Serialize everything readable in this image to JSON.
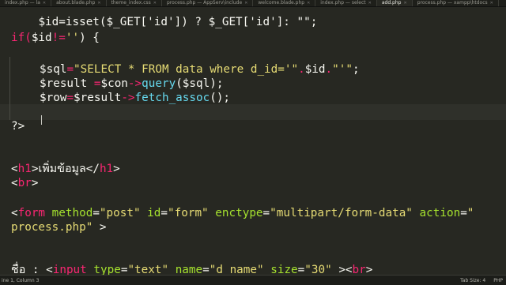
{
  "tabs": [
    {
      "label": "index.php — la",
      "active": false
    },
    {
      "label": "about.blade.php",
      "active": false
    },
    {
      "label": "theme_index.css",
      "active": false
    },
    {
      "label": "process.php — AppServ\\include",
      "active": false
    },
    {
      "label": "welcome.blade.php",
      "active": false
    },
    {
      "label": "index.php — select",
      "active": false
    },
    {
      "label": "add.php",
      "active": true
    },
    {
      "label": "process.php — xampp\\htdocs",
      "active": false
    }
  ],
  "code": {
    "l0": {
      "a": "$id=isset($_GET['id']) ? $_GET['id']: \"\";"
    },
    "l1": {
      "a": "if(",
      "b": "$id",
      "c": "!=",
      "d": "''",
      "e": ") {"
    },
    "l2": {
      "a": "$sql",
      "b": "=",
      "c": "\"SELECT * FROM data where d_id='\"",
      "d": ".",
      "e": "$id",
      "f": ".",
      "g": "\"'\"",
      "h": ";"
    },
    "l3": {
      "a": "$result ",
      "b": "=",
      "c": "$con",
      "d": "->",
      "e": "query",
      "f": "($sql);"
    },
    "l4": {
      "a": "$row",
      "b": "=",
      "c": "$result",
      "d": "->",
      "e": "fetch_assoc",
      "f": "();"
    },
    "l5": {
      "a": "?>"
    },
    "l6": {
      "a": "<",
      "b": "h1",
      "c": ">เพิ่มข้อมูล</",
      "d": "h1",
      "e": ">"
    },
    "l7": {
      "a": "<",
      "b": "br",
      "c": ">"
    },
    "l8": {
      "a": "<",
      "b": "form",
      "c": " method",
      "d": "=",
      "e": "\"post\"",
      "f": " id",
      "g": "=",
      "h": "\"form\"",
      "i": " enctype",
      "j": "=",
      "k": "\"multipart/form-data\"",
      "l": " action",
      "m": "=",
      "n": "\""
    },
    "l9": {
      "a": "process.php\"",
      "b": " >"
    },
    "l10": {
      "a": "ชื่อ : <",
      "b": "input",
      "c": " type",
      "d": "=",
      "e": "\"text\"",
      "f": " name",
      "g": "=",
      "h": "\"d_name\"",
      "i": " size",
      "j": "=",
      "k": "\"30\"",
      "l": " ><",
      "m": "br",
      "n": ">"
    }
  },
  "status": {
    "left": "ine 1, Column 3",
    "tab_size": "Tab Size: 4",
    "syntax": "PHP"
  },
  "colors": {
    "background": "#272822",
    "keyword": "#f92672",
    "string": "#e6db74",
    "function": "#66d9ef",
    "attribute": "#a6e22e"
  }
}
